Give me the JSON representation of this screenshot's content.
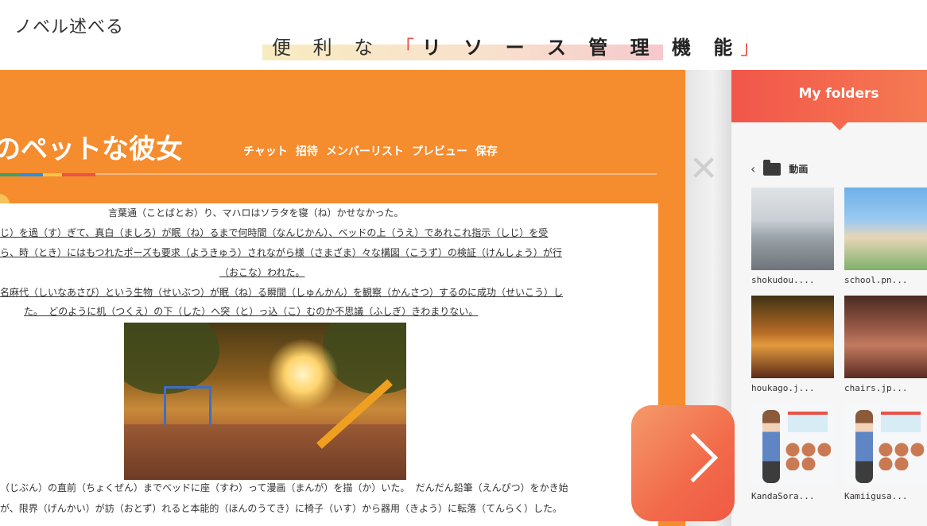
{
  "brand": {
    "logo_text": "ノベル述べる"
  },
  "headline": {
    "prefix": "便 利 な ",
    "open": "「",
    "main": "リ ソ ー ス 管 理 機 能",
    "close": "」"
  },
  "app": {
    "title": "のペットな彼女",
    "nav": [
      "チャット",
      "招待",
      "メンバーリスト",
      "プレビュー",
      "保存"
    ],
    "paragraph_lines": [
      "言葉通（ことばとお）り、マハロはソラタを寝（ね）かせなかった。",
      "じ）を過（す）ぎて、真白（ましろ）が眠（ね）るまで何時間（なんじかん）、ベッドの上（うえ）であれこれ指示（しじ）を受",
      "ら、時（とき）にはもつれたポーズも要求（ようきゅう）されながら様（さまざま）々な構図（こうず）の検証（けんしょう）が行",
      "（おこな）われた。",
      "名麻代（しいなあさび）という生物（せいぶつ）が眠（ね）る瞬間（しゅんかん）を観察（かんさつ）するのに成功（せいこう）し",
      "た。 どのように机（つくえ）の下（した）へ突（と）っ込（こ）むのか不思議（ふしぎ）きわまりない。"
    ],
    "bottom_lines": [
      "（じぶん）の直前（ちょくぜん）までベッドに座（すわ）って漫画（まんが）を描（か）いた。 だんだん鉛筆（えんぴつ）をかき始",
      "が、限界（げんかい）が訪（おとず）れると本能的（ほんのうてき）に椅子（いす）から器用（きよう）に転落（てんらく）した。"
    ]
  },
  "folders": {
    "title": "My folders",
    "current": "動画",
    "files": [
      "shokudou....",
      "school.pn...",
      "houkago.j...",
      "chairs.jp...",
      "KandaSora...",
      "Kamiigusa..."
    ]
  },
  "colors": {
    "accent": "#f58c2e",
    "panel_header": "#f2564a",
    "highlight": "#f8e1cc"
  }
}
